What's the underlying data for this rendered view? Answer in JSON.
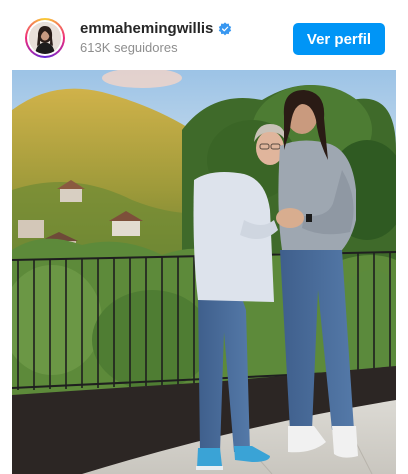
{
  "profile": {
    "username": "emmahemingwillis",
    "verified": true,
    "followers": "613K seguidores",
    "follow_label": "Ver perfil",
    "avatar_icon": "profile-photo",
    "verified_icon": "verified-badge-icon"
  },
  "post": {
    "image_icon": "photo-two-women-on-terrace"
  },
  "colors": {
    "button": "#0095f6",
    "username": "#262626",
    "secondary_text": "#8e8e8e",
    "verified": "#3897f0"
  }
}
